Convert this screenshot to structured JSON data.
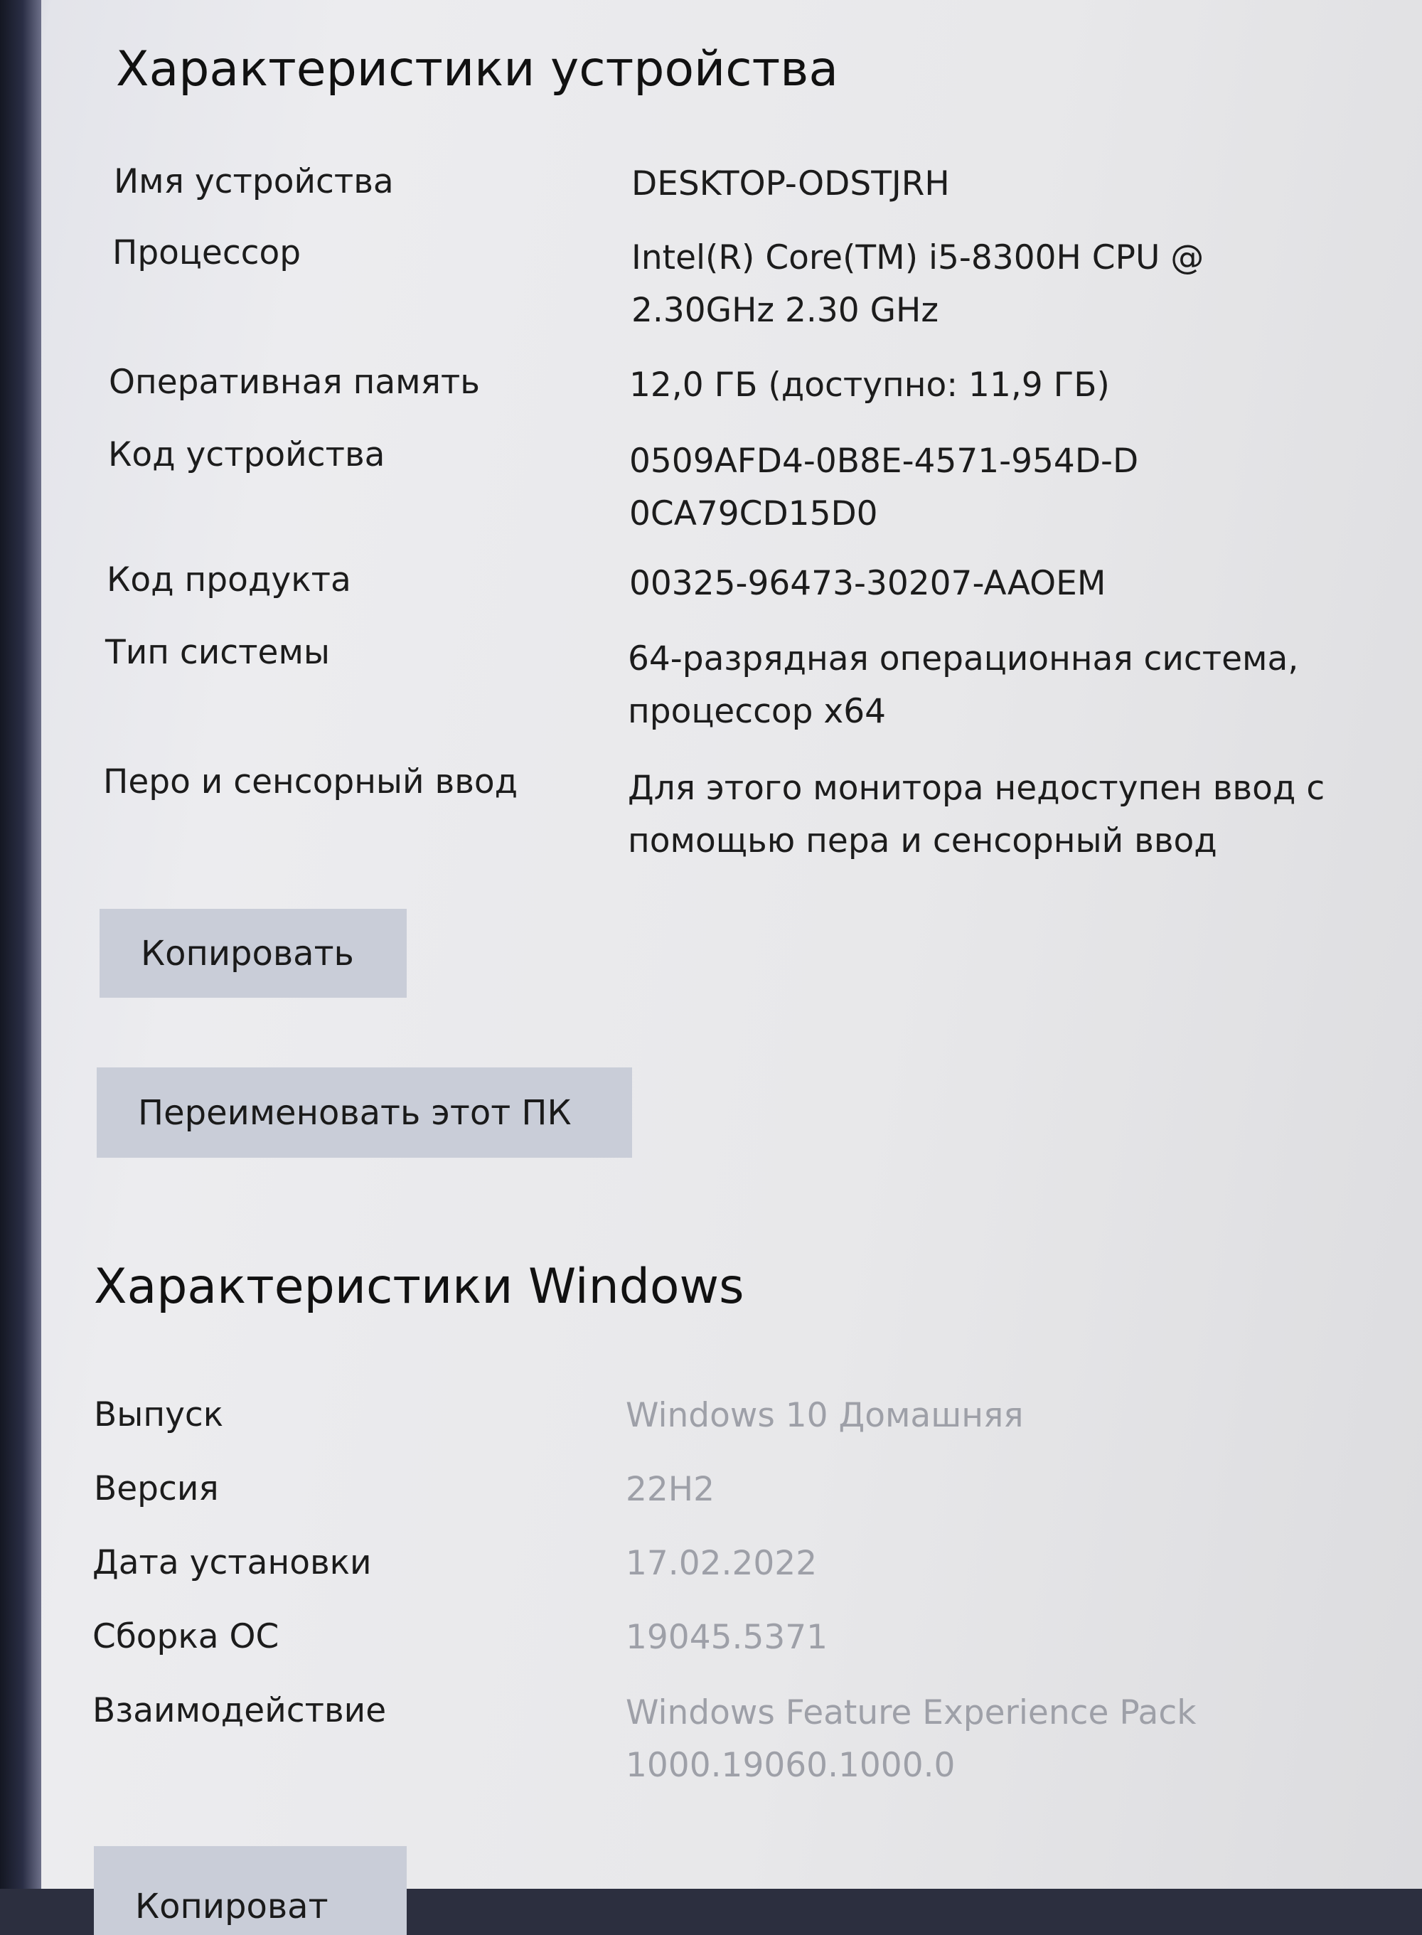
{
  "device_specs": {
    "title": "Характеристики устройства",
    "rows": [
      {
        "label": "Имя устройства",
        "value": "DESKTOP-ODSTJRH"
      },
      {
        "label": "Процессор",
        "value": "Intel(R) Core(TM) i5-8300H CPU @ 2.30GHz   2.30 GHz"
      },
      {
        "label": "Оперативная память",
        "value": "12,0 ГБ (доступно: 11,9 ГБ)"
      },
      {
        "label": "Код устройства",
        "value": "0509AFD4-0B8E-4571-954D-D0CA79CD15D0"
      },
      {
        "label": "Код продукта",
        "value": "00325-96473-30207-AAOEM"
      },
      {
        "label": "Тип системы",
        "value": "64-разрядная операционная система, процессор x64"
      },
      {
        "label": "Перо и сенсорный ввод",
        "value": "Для этого монитора недоступен ввод с помощью пера и сенсорный ввод"
      }
    ],
    "copy_button": "Копировать",
    "rename_button": "Переименовать этот ПК"
  },
  "windows_specs": {
    "title": "Характеристики Windows",
    "rows": [
      {
        "label": "Выпуск",
        "value": "Windows 10 Домашняя"
      },
      {
        "label": "Версия",
        "value": "22H2"
      },
      {
        "label": "Дата установки",
        "value": "17.02.2022"
      },
      {
        "label": "Сборка ОС",
        "value": "19045.5371"
      },
      {
        "label": "Взаимодействие",
        "value": "Windows Feature Experience Pack 1000.19060.1000.0"
      }
    ],
    "copy_button": "Копироват"
  }
}
